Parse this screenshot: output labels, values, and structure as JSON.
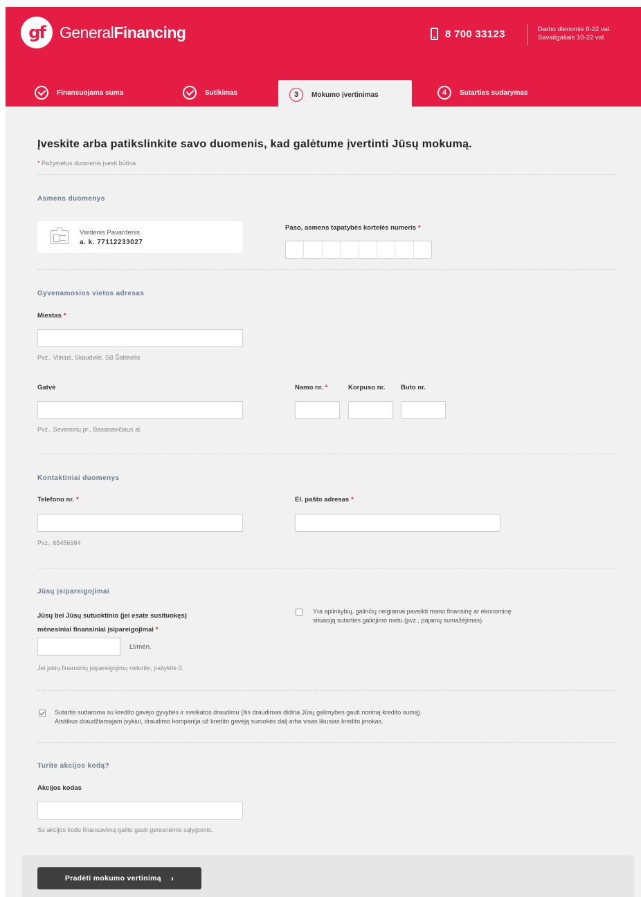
{
  "header": {
    "logo_mark": "gf",
    "brand_first": "General",
    "brand_second": "Financing",
    "phone": "8 700 33123",
    "hours_line1": "Darbo dienomis 8-22 val.",
    "hours_line2": "Savaitgaliais 10-22 val.",
    "brand_color": "#e51c44"
  },
  "steps": [
    {
      "number": "1",
      "label": "Finansuojama suma",
      "status": "done"
    },
    {
      "number": "2",
      "label": "Sutikimas",
      "status": "done"
    },
    {
      "number": "3",
      "label": "Mokumo įvertinimas",
      "status": "active"
    },
    {
      "number": "4",
      "label": "Sutarties sudarymas",
      "status": "upcoming"
    }
  ],
  "form": {
    "title": "Įveskite arba patikslinkite savo duomenis, kad galėtume įvertinti Jūsų mokumą.",
    "required_note": "Pažymėtus duomenis įvesti būtina",
    "personal": {
      "section_title": "Asmens duomenys",
      "name": "Vardenis Pavardenis",
      "code": "a. k. 77112233027",
      "passport_label": "Paso, asmens tapatybės kortelės numeris"
    },
    "address": {
      "section_title": "Gyvenamosios vietos adresas",
      "city_label": "Miestas",
      "city_hint": "Pvz., Vilnius, Skaudvilė, SB Šaltinėlis",
      "street_label": "Gatvė",
      "street_hint": "Pvz., Sevenorių pr., Basanavičiaus al.",
      "house_label": "Namo nr.",
      "building_label": "Korpuso nr.",
      "flat_label": "Buto nr."
    },
    "contacts": {
      "section_title": "Kontaktiniai duomenys",
      "phone_label": "Telefono nr.",
      "phone_hint": "Pvz., 65456984",
      "email_label": "El. pašto adresas"
    },
    "obligations": {
      "section_title": "Jūsų įsipareigojimai",
      "label_line1": "Jūsų bei Jūsų sutuoktinio (jei esate susituokęs)",
      "label_line2": "mėnesiniai finansiniai įsipareigojimai",
      "unit": "Lt/mėn.",
      "hint": "Jei jokių finansinių įsipareigojimų neturite, įrašykite 0.",
      "circumstances_line1": "Yra aplinkybių, galinčių neigiamai paveikti mano finansinę ar ekonominę",
      "circumstances_line2": "situaciją sutarties galiojimo metu (pvz., pajamų sumažėjimas).",
      "circumstances_checked": false
    },
    "insurance": {
      "line1": "Sutartis sudaroma su kredito gavėjo gyvybės ir sveikatos draudimu (šis draudimas didina Jūsų galimybes gauti norimą kredito sumą).",
      "line2": "Atsitikus draudžiamajam įvykiui, draudimo kompanija už kredito gavėją sumokės dalį arba visas likusias kredito įmokas.",
      "checked": true
    },
    "promo": {
      "section_title": "Turite akcijos kodą?",
      "label": "Akcijos kodas",
      "hint": "Su akcijos kodu finansavimą galite gauti geresnėmis sąlygomis."
    },
    "submit_label": "Pradėti mokumo vertinimą",
    "required_star": "*"
  }
}
